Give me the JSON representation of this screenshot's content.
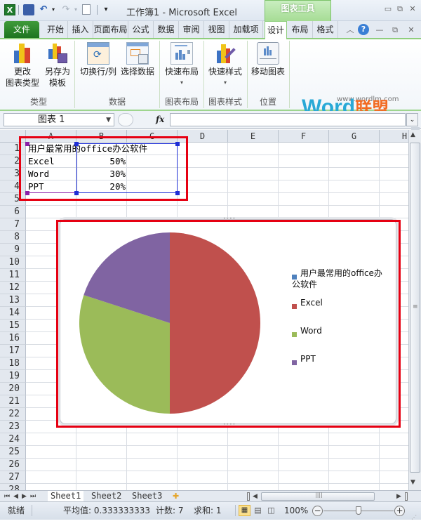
{
  "window": {
    "title": "工作簿1 - Microsoft Excel",
    "contextual_tab_group": "图表工具",
    "controls": {
      "minimize": "▭",
      "restore": "⧉",
      "close": "✕"
    },
    "doc_controls": {
      "collapse_ribbon": "︿",
      "help": "?",
      "minimize": "—",
      "restore": "⧉",
      "close": "✕"
    }
  },
  "quick_access": {
    "items": [
      {
        "name": "excel-logo-icon",
        "glyph": "X"
      },
      {
        "name": "save-icon",
        "glyph": "💾"
      },
      {
        "name": "undo-icon",
        "glyph": "↶"
      },
      {
        "name": "redo-icon",
        "glyph": "↷"
      },
      {
        "name": "new-document-icon",
        "glyph": "🗋"
      },
      {
        "name": "customize-qat-icon",
        "glyph": "▾"
      }
    ]
  },
  "tabs": [
    {
      "label": "文件",
      "kind": "file"
    },
    {
      "label": "开始"
    },
    {
      "label": "插入"
    },
    {
      "label": "页面布局"
    },
    {
      "label": "公式"
    },
    {
      "label": "数据"
    },
    {
      "label": "审阅"
    },
    {
      "label": "视图"
    },
    {
      "label": "加载项"
    },
    {
      "label": "设计",
      "active": true
    },
    {
      "label": "布局"
    },
    {
      "label": "格式"
    }
  ],
  "ribbon": {
    "groups": [
      {
        "label": "类型",
        "buttons": [
          {
            "line1": "更改",
            "line2": "图表类型"
          },
          {
            "line1": "另存为",
            "line2": "模板"
          }
        ]
      },
      {
        "label": "数据",
        "buttons": [
          {
            "line1": "切换行/列"
          },
          {
            "line1": "选择数据"
          }
        ]
      },
      {
        "label": "图表布局",
        "buttons": [
          {
            "line1": "快速布局",
            "dropdown": "▾"
          }
        ]
      },
      {
        "label": "图表样式",
        "buttons": [
          {
            "line1": "快速样式",
            "dropdown": "▾"
          }
        ]
      },
      {
        "label": "位置",
        "buttons": [
          {
            "line1": "移动图表"
          }
        ]
      }
    ],
    "watermark": {
      "url": "www.wordlm.com",
      "word": "Word",
      "cn": "联盟"
    }
  },
  "formula_bar": {
    "name_box": "图表 1",
    "fx": "fx",
    "value": ""
  },
  "sheet": {
    "columns": [
      "A",
      "B",
      "C",
      "D",
      "E",
      "F",
      "G",
      "H"
    ],
    "rows": [
      "1",
      "2",
      "3",
      "4",
      "5",
      "6",
      "7",
      "8",
      "9",
      "10",
      "11",
      "12",
      "13",
      "14",
      "15",
      "16",
      "17",
      "18",
      "19",
      "20",
      "21",
      "22",
      "23",
      "24",
      "25",
      "26",
      "27",
      "28"
    ],
    "cells": {
      "A1": "用户最常用的office办公软件",
      "A2": "Excel",
      "B2": "50%",
      "A3": "Word",
      "B3": "30%",
      "A4": "PPT",
      "B4": "20%"
    }
  },
  "chart_data": {
    "type": "pie",
    "title": "",
    "categories": [
      "Excel",
      "Word",
      "PPT"
    ],
    "values": [
      50,
      30,
      20
    ],
    "unit": "%",
    "colors": [
      "#c0504d",
      "#9bbb59",
      "#8064a2"
    ],
    "start_angle_deg": 0,
    "direction": "clockwise",
    "legend": {
      "position": "right",
      "entries": [
        {
          "label": "用户最常用的office办公软件",
          "color": "#4f81bd"
        },
        {
          "label": "Excel",
          "color": "#c0504d"
        },
        {
          "label": "Word",
          "color": "#9bbb59"
        },
        {
          "label": "PPT",
          "color": "#8064a2"
        }
      ]
    }
  },
  "sheet_tabs": {
    "nav": [
      "⏮",
      "◀",
      "▶",
      "⏭"
    ],
    "tabs": [
      "Sheet1",
      "Sheet2",
      "Sheet3"
    ],
    "active": 0,
    "insert_icon": "✚"
  },
  "status_bar": {
    "ready": "就绪",
    "average": "平均值: 0.333333333",
    "count": "计数: 7",
    "sum": "求和: 1",
    "zoom": "100%",
    "zoom_value_percent": 100,
    "zoom_out": "−",
    "zoom_in": "+"
  }
}
